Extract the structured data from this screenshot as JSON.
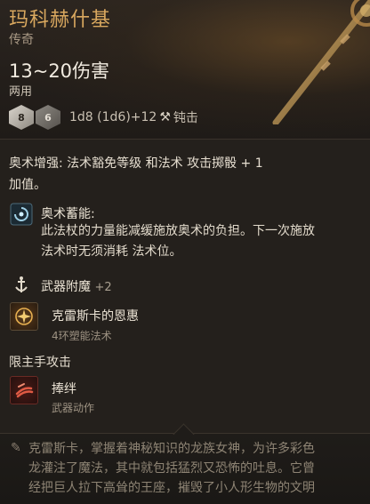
{
  "item": {
    "name": "玛科赫什基",
    "rarity": "传奇",
    "damage": "13~20伤害",
    "hands": "两用",
    "dice": [
      "8",
      "6"
    ],
    "dice_formula": "1d8 (1d6)+12",
    "damage_type": "钝击"
  },
  "passive_text": {
    "line1": "奥术增强: 法术豁免等级 和法术 攻击掷骰 + 1",
    "line2": "加值。"
  },
  "arcane_charge": {
    "title": "奥术蓄能:",
    "desc_line1": "此法杖的力量能减缓施放奥术的负担。下一次施放",
    "desc_line2": "法术时无须消耗 法术位。"
  },
  "enchant": {
    "label": "武器附魔",
    "bonus": "+2"
  },
  "spell": {
    "name": "克雷斯卡的恩惠",
    "sub": "4环塑能法术"
  },
  "mainhand": {
    "label": "限主手攻击"
  },
  "action": {
    "name": "捧绊",
    "sub": "武器动作"
  },
  "lore": {
    "line1": "克雷斯卡，掌握着神秘知识的龙族女神，为许多彩色",
    "line2": "龙灌注了魔法，其中就包括猛烈又恐怖的吐息。它曾",
    "line3": "经把巨人拉下高耸的王座，摧毁了小人形生物的文明"
  },
  "colors": {
    "name_gold": "#d9a85f",
    "body_bg": "#24201c",
    "header_glow": "#785428"
  },
  "icons": {
    "damage_type": "blunt-hammer-icon",
    "arcane_charge": "arcane-swirl-icon",
    "enchant": "anchor-enchant-icon",
    "spell": "sun-burst-icon",
    "action": "trip-weapon-icon",
    "lore": "scroll-quill-icon"
  }
}
